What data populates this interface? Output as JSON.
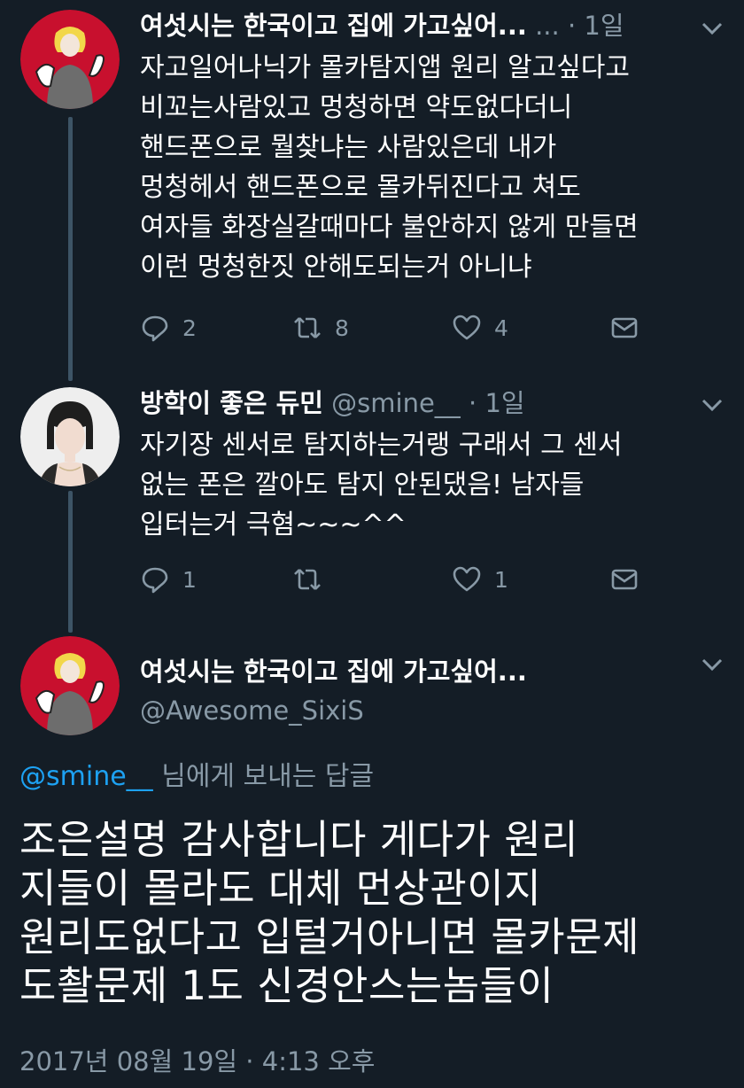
{
  "tweets": [
    {
      "name": "여섯시는 한국이고 집에 가고싶어...",
      "meta": "· 1일",
      "lines": [
        "자고일어나닉가 몰카탐지앱 원리 알고싶다고",
        "비꼬는사람있고 멍청하면 약도없다더니",
        "핸드폰으로 뭘찾냐는 사람있은데 내가",
        "멍청헤서 핸드폰으로 몰카뒤진다고 쳐도",
        "여자들 화장실갈때마다 불안하지 않게 만들면",
        "이런 멍청한짓 안해도되는거 아니냐"
      ],
      "replies": "2",
      "retweets": "8",
      "likes": "4"
    },
    {
      "name": "방학이 좋은 듀민",
      "handle": "@smine__",
      "meta": "· 1일",
      "lines": [
        "자기장 센서로 탐지하는거랭 구래서 그 센서",
        "없는 폰은 깔아도 탐지 안된댔음! 남자들",
        "입터는거 극혐~~~^^"
      ],
      "replies": "1",
      "retweets": "",
      "likes": "1"
    }
  ],
  "main_tweet": {
    "name": "여섯시는 한국이고 집에 가고싶어...",
    "handle": "@Awesome_SixiS",
    "reply_mention": "@smine__",
    "reply_suffix": "님에게 보내는 답글",
    "lines": [
      "조은설명 감사합니다 게다가 원리",
      "지들이 몰라도 대체 먼상관이지",
      "원리도없다고 입털거아니면 몰카문제",
      "도촬문제 1도 신경안스는놈들이"
    ],
    "timestamp": "2017년 08월 19일 · 4:13 오후"
  },
  "colors": {
    "background": "#141d26",
    "text": "#ffffff",
    "secondary": "#8899a6",
    "link": "#1da1f2",
    "avatar_red": "#c8102e"
  },
  "icons": [
    "reply-icon",
    "retweet-icon",
    "like-icon",
    "dm-icon",
    "chevron-down-icon"
  ]
}
